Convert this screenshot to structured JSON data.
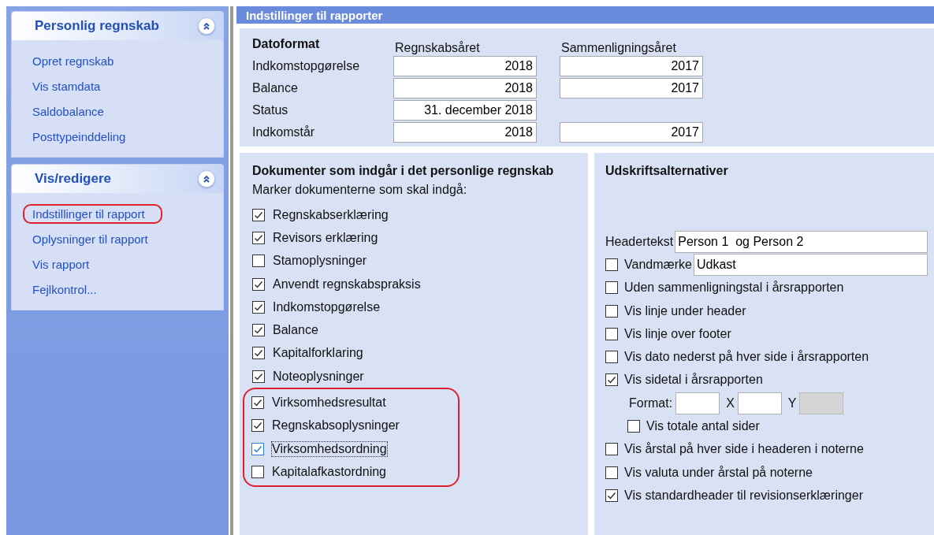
{
  "sidebar": {
    "groups": [
      {
        "title": "Personlig regnskab",
        "expanded": true,
        "items": [
          {
            "label": "Opret regnskab",
            "circled": false
          },
          {
            "label": "Vis stamdata",
            "circled": false
          },
          {
            "label": "Saldobalance",
            "circled": false
          },
          {
            "label": "Posttypeinddeling",
            "circled": false
          }
        ]
      },
      {
        "title": "Vis/redigere",
        "expanded": true,
        "items": [
          {
            "label": "Indstillinger til rapport",
            "circled": true
          },
          {
            "label": "Oplysninger til rapport",
            "circled": false
          },
          {
            "label": "Vis rapport",
            "circled": false
          },
          {
            "label": "Fejlkontrol...",
            "circled": false
          }
        ]
      }
    ]
  },
  "main": {
    "title": "Indstillinger til rapporter",
    "date_format": {
      "title": "Datoformat",
      "columns": [
        "Regnskabsåret",
        "Sammenligningsåret"
      ],
      "rows": [
        {
          "label": "Indkomstopgørelse",
          "values": [
            "2018",
            "2017"
          ]
        },
        {
          "label": "Balance",
          "values": [
            "2018",
            "2017"
          ]
        },
        {
          "label": "Status",
          "values": [
            "31. december 2018"
          ]
        },
        {
          "label": "Indkomstår",
          "values": [
            "2018",
            "2017"
          ]
        }
      ]
    },
    "documents": {
      "title": "Dokumenter som indgår i det personlige regnskab",
      "subtitle": "Marker dokumenterne som skal indgå:",
      "items": [
        {
          "label": "Regnskabserklæring",
          "checked": true,
          "focused": false,
          "circled": false
        },
        {
          "label": "Revisors erklæring",
          "checked": true,
          "focused": false,
          "circled": false
        },
        {
          "label": "Stamoplysninger",
          "checked": false,
          "focused": false,
          "circled": false
        },
        {
          "label": "Anvendt regnskabspraksis",
          "checked": true,
          "focused": false,
          "circled": false
        },
        {
          "label": "Indkomstopgørelse",
          "checked": true,
          "focused": false,
          "circled": false
        },
        {
          "label": "Balance",
          "checked": true,
          "focused": false,
          "circled": false
        },
        {
          "label": "Kapitalforklaring",
          "checked": true,
          "focused": false,
          "circled": false
        },
        {
          "label": "Noteoplysninger",
          "checked": true,
          "focused": false,
          "circled": false
        },
        {
          "label": "Virksomhedsresultat",
          "checked": true,
          "focused": false,
          "circled": true
        },
        {
          "label": "Regnskabsoplysninger",
          "checked": true,
          "focused": false,
          "circled": true
        },
        {
          "label": "Virksomhedsordning",
          "checked": true,
          "focused": true,
          "circled": true
        },
        {
          "label": "Kapitalafkastordning",
          "checked": false,
          "focused": false,
          "circled": true
        }
      ]
    },
    "print_options": {
      "title": "Udskriftsalternativer",
      "items": [
        {
          "kind": "text",
          "label": "Headertekst",
          "value": "Person 1  og Person 2"
        },
        {
          "kind": "check_text",
          "label": "Vandmærke",
          "checked": false,
          "value": "Udkast"
        },
        {
          "kind": "check",
          "label": "Uden sammenligningstal i årsrapporten",
          "checked": false
        },
        {
          "kind": "check",
          "label": "Vis linje under header",
          "checked": false
        },
        {
          "kind": "check",
          "label": "Vis linje over footer",
          "checked": false
        },
        {
          "kind": "check",
          "label": "Vis dato nederst på hver side i årsrapporten",
          "checked": false
        },
        {
          "kind": "check",
          "label": "Vis sidetal i årsrapporten",
          "checked": true
        },
        {
          "kind": "format",
          "fields": [
            {
              "label": "Format:",
              "disabled": false
            },
            {
              "label": "X",
              "disabled": false
            },
            {
              "label": "Y",
              "disabled": true
            }
          ]
        },
        {
          "kind": "subcheck",
          "label": "Vis totale antal sider",
          "checked": false
        },
        {
          "kind": "check",
          "label": "Vis årstal på hver side i headeren i noterne",
          "checked": false
        },
        {
          "kind": "check",
          "label": "Vis valuta under årstal på noterne",
          "checked": false
        },
        {
          "kind": "check",
          "label": "Vis standardheader til revisionserklæringer",
          "checked": true
        }
      ]
    }
  }
}
